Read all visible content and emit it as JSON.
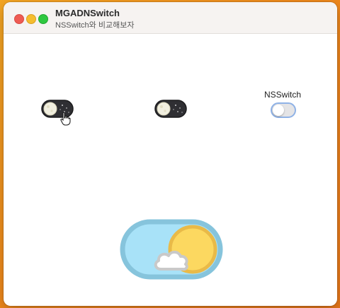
{
  "window": {
    "title": "MGADNSwitch",
    "subtitle": "NSSwitch와 비교해보자"
  },
  "controls": {
    "nsswitch_label": "NSSwitch"
  },
  "icons": {
    "close": "close-dot",
    "minimize": "minimize-dot",
    "zoom": "zoom-dot",
    "cursor": "hand-pointer-icon",
    "night_switch": "moon-with-stars-icon",
    "day_switch": "sun-with-cloud-icon"
  },
  "colors": {
    "night_track": "#2f2f33",
    "moon": "#f1efe0",
    "day_track": "#a8e2f8",
    "day_border": "#86c4dc",
    "sun": "#fcd860",
    "sun_rim": "#e9ba48",
    "ns_border": "#8fb2e6"
  }
}
